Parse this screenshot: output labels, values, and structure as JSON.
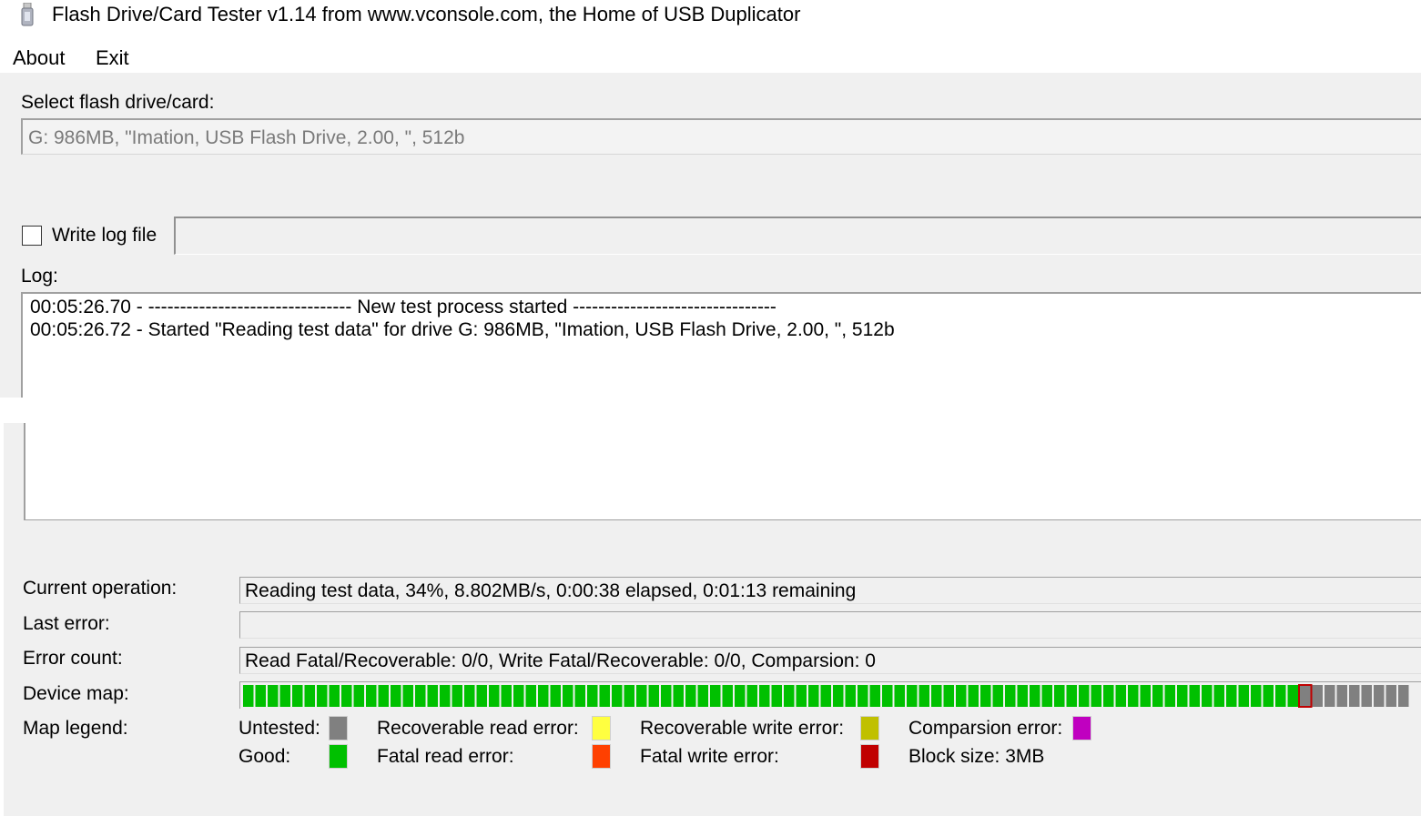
{
  "window": {
    "title": "Flash Drive/Card Tester v1.14 from www.vconsole.com, the Home of USB Duplicator"
  },
  "menu": {
    "about": "About",
    "exit": "Exit"
  },
  "drive": {
    "label": "Select flash drive/card:",
    "value": "G: 986MB, \"Imation, USB Flash Drive, 2.00, \", 512b"
  },
  "logfile": {
    "checkbox_label": "Write log file",
    "checked": false,
    "path": ""
  },
  "log": {
    "label": "Log:",
    "lines": [
      "00:05:26.70 - -------------------------------- New test process started --------------------------------",
      "00:05:26.72 - Started \"Reading test data\" for drive G: 986MB, \"Imation, USB Flash Drive, 2.00, \", 512b"
    ]
  },
  "status": {
    "current_operation_label": "Current operation:",
    "current_operation": "Reading test data, 34%, 8.802MB/s, 0:00:38 elapsed, 0:01:13 remaining",
    "last_error_label": "Last error:",
    "last_error": "",
    "error_count_label": "Error count:",
    "error_count": "Read Fatal/Recoverable: 0/0, Write Fatal/Recoverable: 0/0, Comparsion: 0"
  },
  "device_map": {
    "label": "Device map:",
    "good_blocks": 86,
    "current_block": 87,
    "untested_visible": 8,
    "colors": {
      "good": "#00c000",
      "untested": "#808080",
      "current_border": "#c00000"
    }
  },
  "legend": {
    "label": "Map legend:",
    "items": [
      {
        "label": "Untested:",
        "color": "#808080"
      },
      {
        "label": "Good:",
        "color": "#00c000"
      },
      {
        "label": "Recoverable read error:",
        "color": "#ffff40"
      },
      {
        "label": "Fatal read error:",
        "color": "#ff4000"
      },
      {
        "label": "Recoverable write error:",
        "color": "#c0c000"
      },
      {
        "label": "Fatal write error:",
        "color": "#c00000"
      },
      {
        "label": "Comparsion error:",
        "color": "#c000c0"
      }
    ],
    "block_size": "Block size: 3MB"
  }
}
